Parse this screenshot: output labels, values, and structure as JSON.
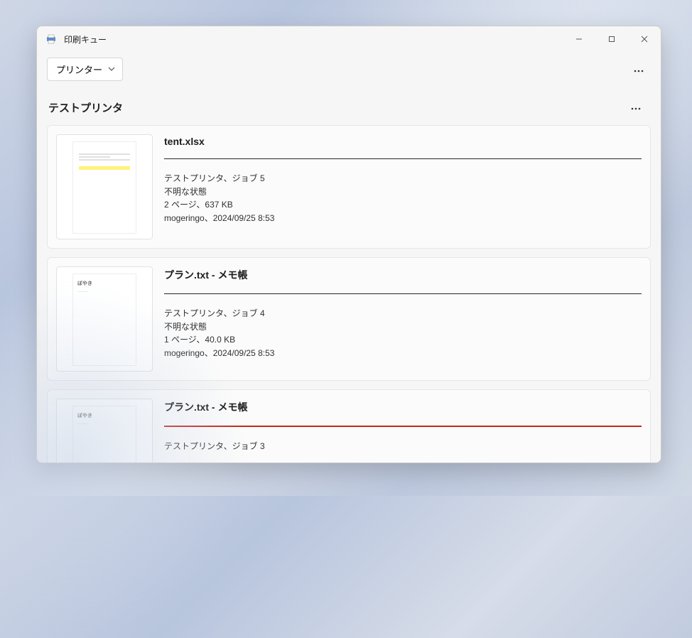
{
  "window": {
    "title": "印刷キュー"
  },
  "toolbar": {
    "printer_dropdown_label": "プリンター"
  },
  "printer": {
    "name": "テストプリンタ"
  },
  "jobs": [
    {
      "filename": "tent.xlsx",
      "printer_job": "テストプリンタ、ジョブ 5",
      "status": "不明な状態",
      "pages_size": "2 ページ、637 KB",
      "owner_time": "mogeringo、2024/09/25 8:53",
      "thumb_style": "xlsx",
      "error": false
    },
    {
      "filename": "プラン.txt - メモ帳",
      "printer_job": "テストプリンタ、ジョブ 4",
      "status": "不明な状態",
      "pages_size": "1 ページ、40.0 KB",
      "owner_time": "mogeringo、2024/09/25 8:53",
      "thumb_style": "txt",
      "error": false
    },
    {
      "filename": "プラン.txt - メモ帳",
      "printer_job": "テストプリンタ、ジョブ 3",
      "status": "",
      "pages_size": "",
      "owner_time": "",
      "thumb_style": "txt",
      "error": true
    }
  ]
}
